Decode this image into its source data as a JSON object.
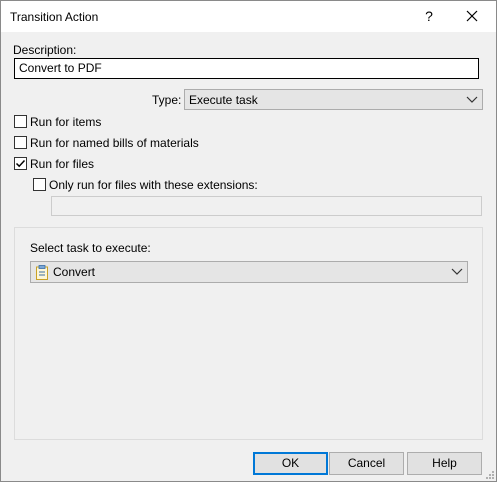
{
  "window": {
    "title": "Transition Action",
    "help_glyph": "?"
  },
  "description": {
    "label": "Description:",
    "value": "Convert to PDF"
  },
  "type": {
    "label": "Type:",
    "selected": "Execute task"
  },
  "options": [
    {
      "label": "Run for items",
      "checked": false
    },
    {
      "label": "Run for named bills of materials",
      "checked": false
    },
    {
      "label": "Run for files",
      "checked": true
    },
    {
      "label": "Only run for files with these extensions:",
      "checked": false
    }
  ],
  "extensions": {
    "value": "",
    "enabled": false
  },
  "task": {
    "label": "Select task to execute:",
    "selected": "Convert",
    "icon": "clipboard-icon"
  },
  "buttons": {
    "ok": "OK",
    "cancel": "Cancel",
    "help": "Help"
  },
  "colors": {
    "default_button_border": "#0078d7",
    "dialog_background": "#f0f0f0"
  }
}
